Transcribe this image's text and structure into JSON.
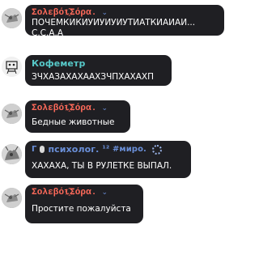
{
  "colors": {
    "bubble_bg": "#1f1f23",
    "name_sorebol": "#ff6a5a",
    "name_kofemetr": "#57c8c8",
    "name_psiholog": "#6a8fd8",
    "text": "#ffffff"
  },
  "messages": [
    {
      "author": "Σολεβόι҈Σόρα.",
      "author_color": "#ff6a5a",
      "icon": "chevron-down-icon",
      "text": "ПОЧЕМКИКИУИУИУИУТИАТКИАИАИ...\nС.С.А.А"
    },
    {
      "author": "Кофеметр",
      "author_color": "#57c8c8",
      "text": "ЗЧХАЗАХАХААХЗЧПХАХАХП"
    },
    {
      "author": "Σολεβόι҈Σόρα.",
      "author_color": "#ff6a5a",
      "icon": "chevron-down-icon",
      "text": "Бедные животные"
    },
    {
      "author_prefix": "Γ",
      "author": "психолог.",
      "author_suffix": "¹² #миро.",
      "author_color": "#6a8fd8",
      "text": "ХАХАХА, ТЫ В РУЛЕТКЕ ВЫПАЛ."
    },
    {
      "author": "Σολεβόι҈Σόρα.",
      "author_color": "#ff6a5a",
      "icon": "chevron-down-icon",
      "text": "Простите пожалуйста"
    }
  ]
}
